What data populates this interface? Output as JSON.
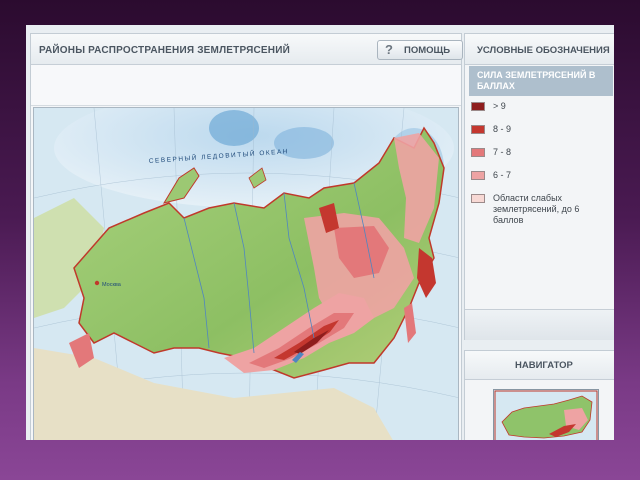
{
  "left_panel": {
    "title": "РАЙОНЫ РАСПРОСТРАНЕНИЯ ЗЕМЛЕТРЯСЕНИЙ",
    "help_label": "ПОМОЩЬ",
    "help_icon": "question-icon",
    "map_label": "СЕВЕРНЫЙ ЛЕДОВИТЫЙ ОКЕАН",
    "city_label": "Москва"
  },
  "legend": {
    "title": "УСЛОВНЫЕ ОБОЗНАЧЕНИЯ",
    "subtitle": "СИЛА ЗЕМЛЕТРЯСЕНИЙ В БАЛЛАХ",
    "items": [
      {
        "label": "> 9",
        "color": "#8e1d1d"
      },
      {
        "label": "8 - 9",
        "color": "#c4372f"
      },
      {
        "label": "7 - 8",
        "color": "#e3787a"
      },
      {
        "label": "6 - 7",
        "color": "#eea3a3"
      },
      {
        "label": "Области слабых землетрясений, до 6 баллов",
        "color": "#f7d8d4"
      }
    ]
  },
  "navigator": {
    "title": "НАВИГАТОР"
  },
  "colors": {
    "land_green": "#8fc36a",
    "ocean": "#cfe4ef",
    "border_red": "#c0392b"
  }
}
